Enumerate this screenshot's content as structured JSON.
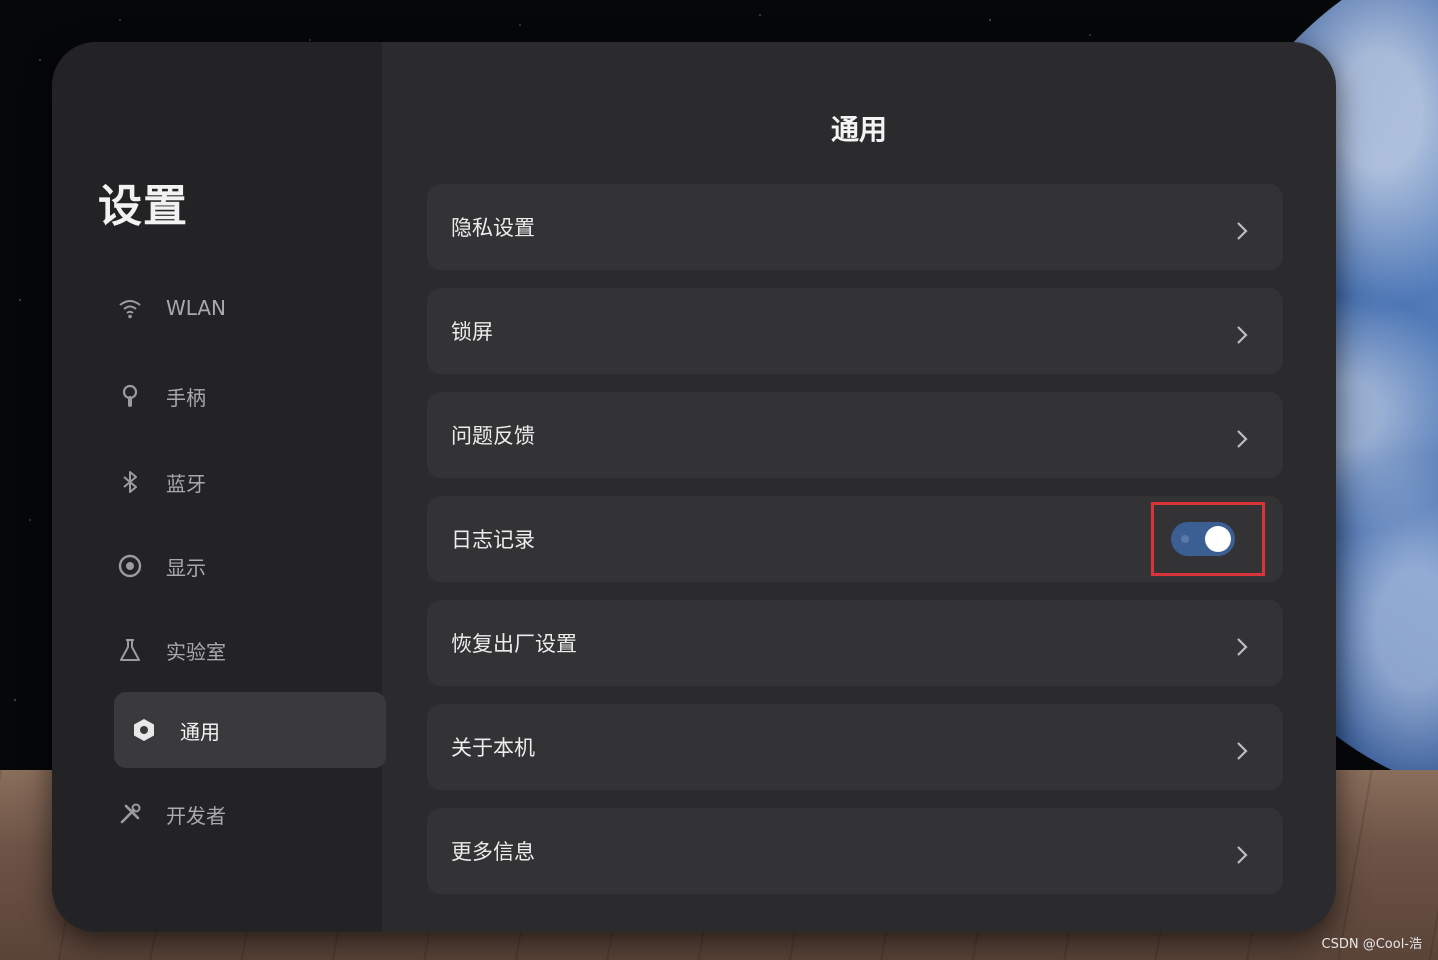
{
  "sidebar": {
    "title": "设置",
    "items": [
      {
        "label": "WLAN",
        "icon": "wifi-icon"
      },
      {
        "label": "手柄",
        "icon": "controller-icon"
      },
      {
        "label": "蓝牙",
        "icon": "bluetooth-icon"
      },
      {
        "label": "显示",
        "icon": "eye-icon"
      },
      {
        "label": "实验室",
        "icon": "flask-icon"
      },
      {
        "label": "通用",
        "icon": "general-hexagon-icon",
        "active": true
      },
      {
        "label": "开发者",
        "icon": "tools-icon"
      }
    ]
  },
  "main": {
    "title": "通用",
    "rows": [
      {
        "label": "隐私设置",
        "control": "chevron-right-icon"
      },
      {
        "label": "锁屏",
        "control": "chevron-right-icon"
      },
      {
        "label": "问题反馈",
        "control": "chevron-right-icon"
      },
      {
        "label": "日志记录",
        "control": "toggle",
        "toggle_on": true
      },
      {
        "label": "恢复出厂设置",
        "control": "chevron-right-icon"
      },
      {
        "label": "关于本机",
        "control": "chevron-right-icon"
      },
      {
        "label": "更多信息",
        "control": "chevron-right-icon"
      }
    ]
  },
  "colors": {
    "panel": "#2b2b2d",
    "sidebar": "#232325",
    "row": "#333335",
    "toggle_track": "#3b5f93",
    "highlight_box": "#d9343a"
  },
  "watermark": "CSDN @Cool-浩"
}
